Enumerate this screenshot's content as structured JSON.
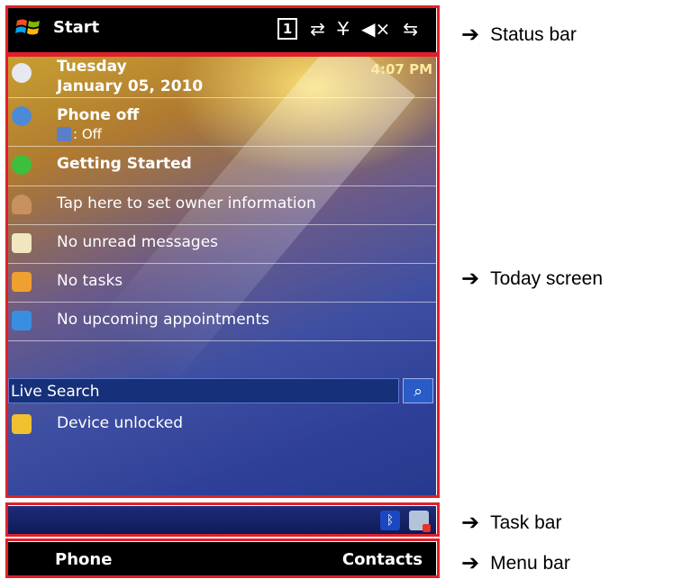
{
  "status_bar": {
    "start_label": "Start",
    "icons": [
      "sim-1-icon",
      "data-sync-icon",
      "no-signal-icon",
      "volume-mute-icon",
      "battery-charging-icon"
    ]
  },
  "today": {
    "day": "Tuesday",
    "date": "January 05, 2010",
    "time": "4:07 PM",
    "phone_status": "Phone off",
    "bluetooth_status": ": Off",
    "getting_started": "Getting Started",
    "owner_info": "Tap here to set owner information",
    "messages": "No unread messages",
    "tasks": "No tasks",
    "appointments": "No upcoming appointments",
    "search_placeholder": "Live Search",
    "device_lock": "Device unlocked"
  },
  "task_bar": {
    "icons": [
      "bluetooth-icon",
      "wifi-off-icon"
    ]
  },
  "menu_bar": {
    "left": "Phone",
    "right": "Contacts"
  },
  "annotations": {
    "status_bar": "Status bar",
    "today_screen": "Today screen",
    "task_bar": "Task bar",
    "menu_bar": "Menu bar"
  },
  "colors": {
    "highlight": "#e0202a"
  }
}
